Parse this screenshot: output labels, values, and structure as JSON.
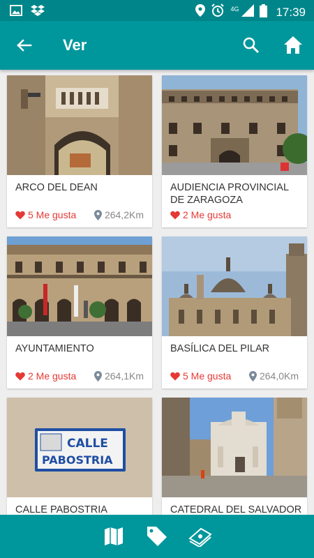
{
  "status_bar": {
    "time": "17:39",
    "network": "4G"
  },
  "app_bar": {
    "title": "Ver"
  },
  "places": [
    {
      "name": "ARCO DEL DEAN",
      "likes": "5 Me gusta",
      "distance": "264,2Km"
    },
    {
      "name": "AUDIENCIA PROVINCIAL DE ZARAGOZA",
      "likes": "2 Me gusta",
      "distance": ""
    },
    {
      "name": "AYUNTAMIENTO",
      "likes": "2 Me gusta",
      "distance": "264,1Km"
    },
    {
      "name": "BASÍLICA DEL PILAR",
      "likes": "5 Me gusta",
      "distance": "264,0Km"
    },
    {
      "name": "CALLE PABOSTRIA",
      "likes": "",
      "distance": ""
    },
    {
      "name": "CATEDRAL DEL SALVADOR",
      "likes": "",
      "distance": ""
    }
  ],
  "street_sign": {
    "line1": "CALLE",
    "line2": "PABOSTRIA"
  },
  "colors": {
    "primary": "#00979c",
    "status_bar": "#00868a",
    "like": "#e53935"
  }
}
